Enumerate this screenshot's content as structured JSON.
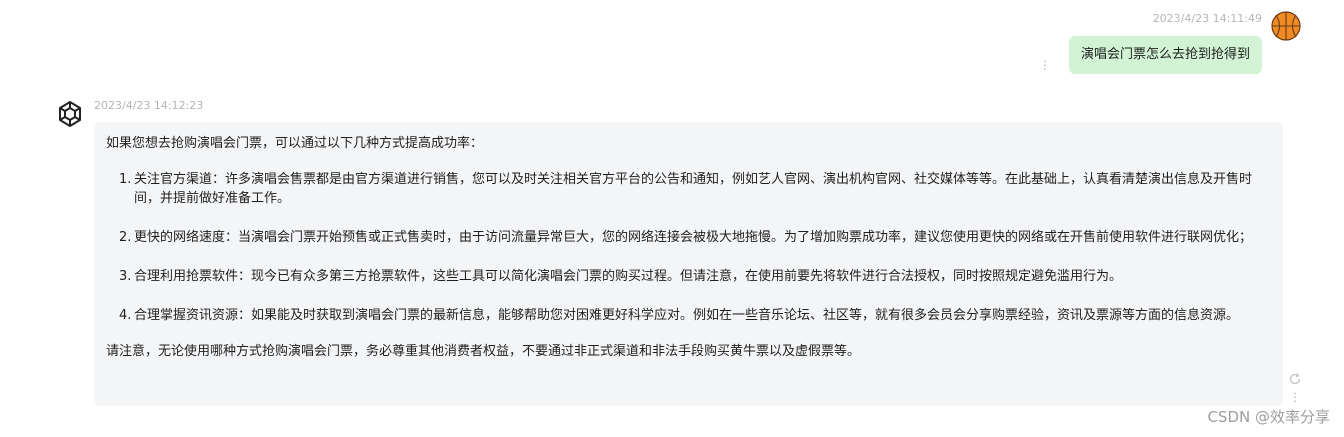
{
  "user_message": {
    "timestamp": "2023/4/23 14:11:49",
    "text": "演唱会门票怎么去抢到抢得到",
    "avatar_icon": "basketball-icon"
  },
  "bot_message": {
    "timestamp": "2023/4/23 14:12:23",
    "avatar_icon": "openai-logo-icon",
    "intro": "如果您想去抢购演唱会门票，可以通过以下几种方式提高成功率：",
    "items": [
      {
        "num": "1.",
        "text": "关注官方渠道：许多演唱会售票都是由官方渠道进行销售，您可以及时关注相关官方平台的公告和通知，例如艺人官网、演出机构官网、社交媒体等等。在此基础上，认真看清楚演出信息及开售时间，并提前做好准备工作。"
      },
      {
        "num": "2.",
        "text": "更快的网络速度：当演唱会门票开始预售或正式售卖时，由于访问流量异常巨大，您的网络连接会被极大地拖慢。为了增加购票成功率，建议您使用更快的网络或在开售前使用软件进行联网优化；"
      },
      {
        "num": "3.",
        "text": "合理利用抢票软件：现今已有众多第三方抢票软件，这些工具可以简化演唱会门票的购买过程。但请注意，在使用前要先将软件进行合法授权，同时按照规定避免滥用行为。"
      },
      {
        "num": "4.",
        "text": "合理掌握资讯资源：如果能及时获取到演唱会门票的最新信息，能够帮助您对困难更好科学应对。例如在一些音乐论坛、社区等，就有很多会员会分享购票经验，资讯及票源等方面的信息资源。"
      }
    ],
    "outro": "请注意，无论使用哪种方式抢购演唱会门票，务必尊重其他消费者权益，不要通过非正式渠道和非法手段购买黄牛票以及虚假票等。"
  },
  "watermark": "CSDN @效率分享",
  "colors": {
    "user_bubble": "#d2f4d5",
    "bot_bubble": "#f4f5f7",
    "timestamp": "#b5b5b5"
  }
}
